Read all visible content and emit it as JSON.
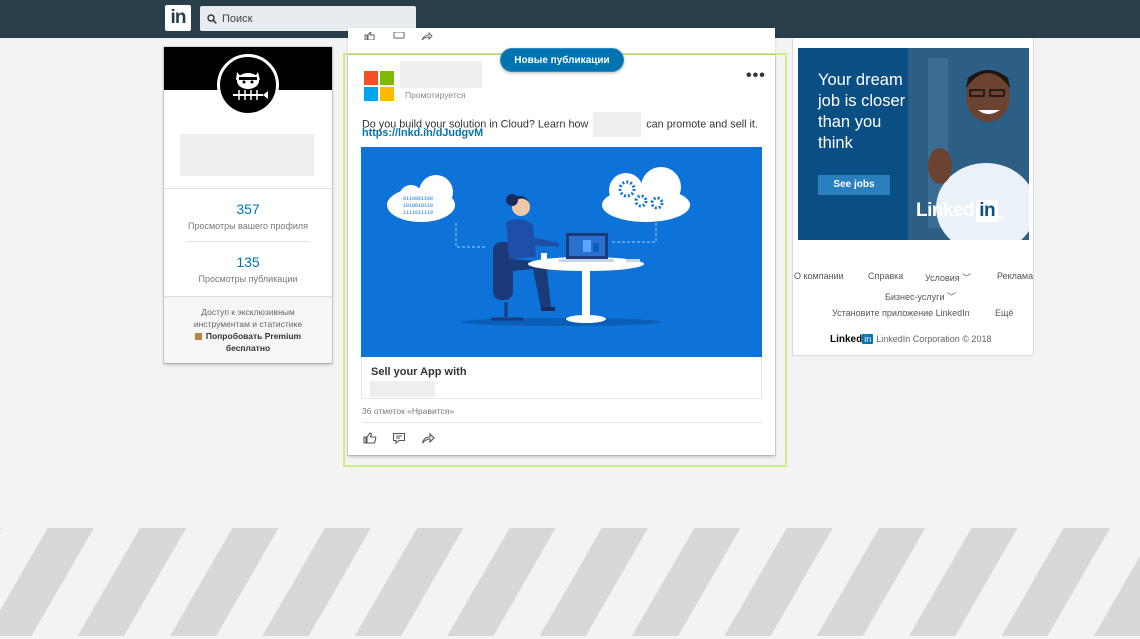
{
  "nav": {
    "logo_text": "in",
    "search_placeholder": "Поиск"
  },
  "profile": {
    "views_profile_count": "357",
    "views_profile_label": "Просмотры вашего профиля",
    "views_posts_count": "135",
    "views_posts_label": "Просмотры публикации",
    "premium_text_line1": "Доступ к эксклюзивным",
    "premium_text_line2": "инструментам и статистике",
    "premium_cta_line1": "Попробовать Premium",
    "premium_cta_line2": "бесплатно"
  },
  "feed": {
    "new_posts_label": "Новые публикации",
    "post": {
      "promoted_label": "Промотируется",
      "more_label": "•••",
      "text_before": "Do you build your solution in Cloud? Learn how",
      "text_after": "can promote and sell it.",
      "link": "https://lnkd.in/dJudgvM",
      "link_title": "Sell your App with",
      "likes_text": "36 отметок «Нравится»",
      "binary_lines": [
        "0110001100",
        "1010010110",
        "1111011110"
      ]
    }
  },
  "ad": {
    "headline_line1": "Your dream",
    "headline_line2": "job is closer",
    "headline_line3": "than you",
    "headline_line4": "think",
    "button_label": "See jobs",
    "brand_text": "Linked",
    "brand_in": "in",
    "brand_tm": "TM"
  },
  "footer": {
    "about": "О компании",
    "help": "Справка",
    "terms": "Условия",
    "ads": "Реклама",
    "business": "Бизнес-услуги",
    "app": "Установите приложение LinkedIn",
    "more": "Ещё",
    "brand_linked": "Linked",
    "brand_in": "in",
    "copyright": "LinkedIn Corporation © 2018"
  },
  "colors": {
    "nav_bg": "#283e4a",
    "link_blue": "#0073b1",
    "image_blue": "#0d73d8",
    "highlight_green": "#c9ec8f",
    "ms_red": "#f25022",
    "ms_green": "#7fba00",
    "ms_blue": "#00a4ef",
    "ms_yellow": "#ffb900"
  }
}
